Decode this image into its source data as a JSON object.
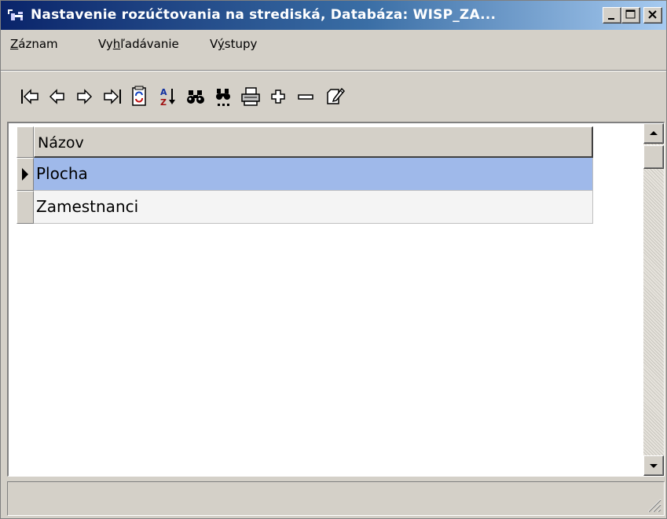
{
  "window": {
    "title": "Nastavenie rozúčtovania na strediská,  Databáza: WISP_ZA...",
    "buttons": [
      "minimize-icon",
      "maximize-icon",
      "close-icon"
    ]
  },
  "menu": {
    "items": [
      {
        "pre": "",
        "ul": "Z",
        "post": "áznam"
      },
      {
        "pre": "Vy",
        "ul": "h",
        "post": "ľadávanie"
      },
      {
        "pre": "V",
        "ul": "ý",
        "post": "stupy"
      }
    ]
  },
  "toolbar": {
    "icons": [
      "first-record-icon",
      "prev-record-icon",
      "next-record-icon",
      "last-record-icon",
      "refresh-icon",
      "sort-az-icon",
      "find-icon",
      "find-next-icon",
      "print-icon",
      "add-record-icon",
      "delete-record-icon",
      "edit-record-icon"
    ]
  },
  "grid": {
    "column_header": "Názov",
    "rows": [
      {
        "name": "Plocha",
        "selected": true
      },
      {
        "name": "Zamestnanci",
        "selected": false
      }
    ]
  },
  "colors": {
    "title_start": "#0a246a",
    "title_end": "#a6caf0",
    "selected_row": "#9fb9ea",
    "face": "#d4d0c8"
  }
}
